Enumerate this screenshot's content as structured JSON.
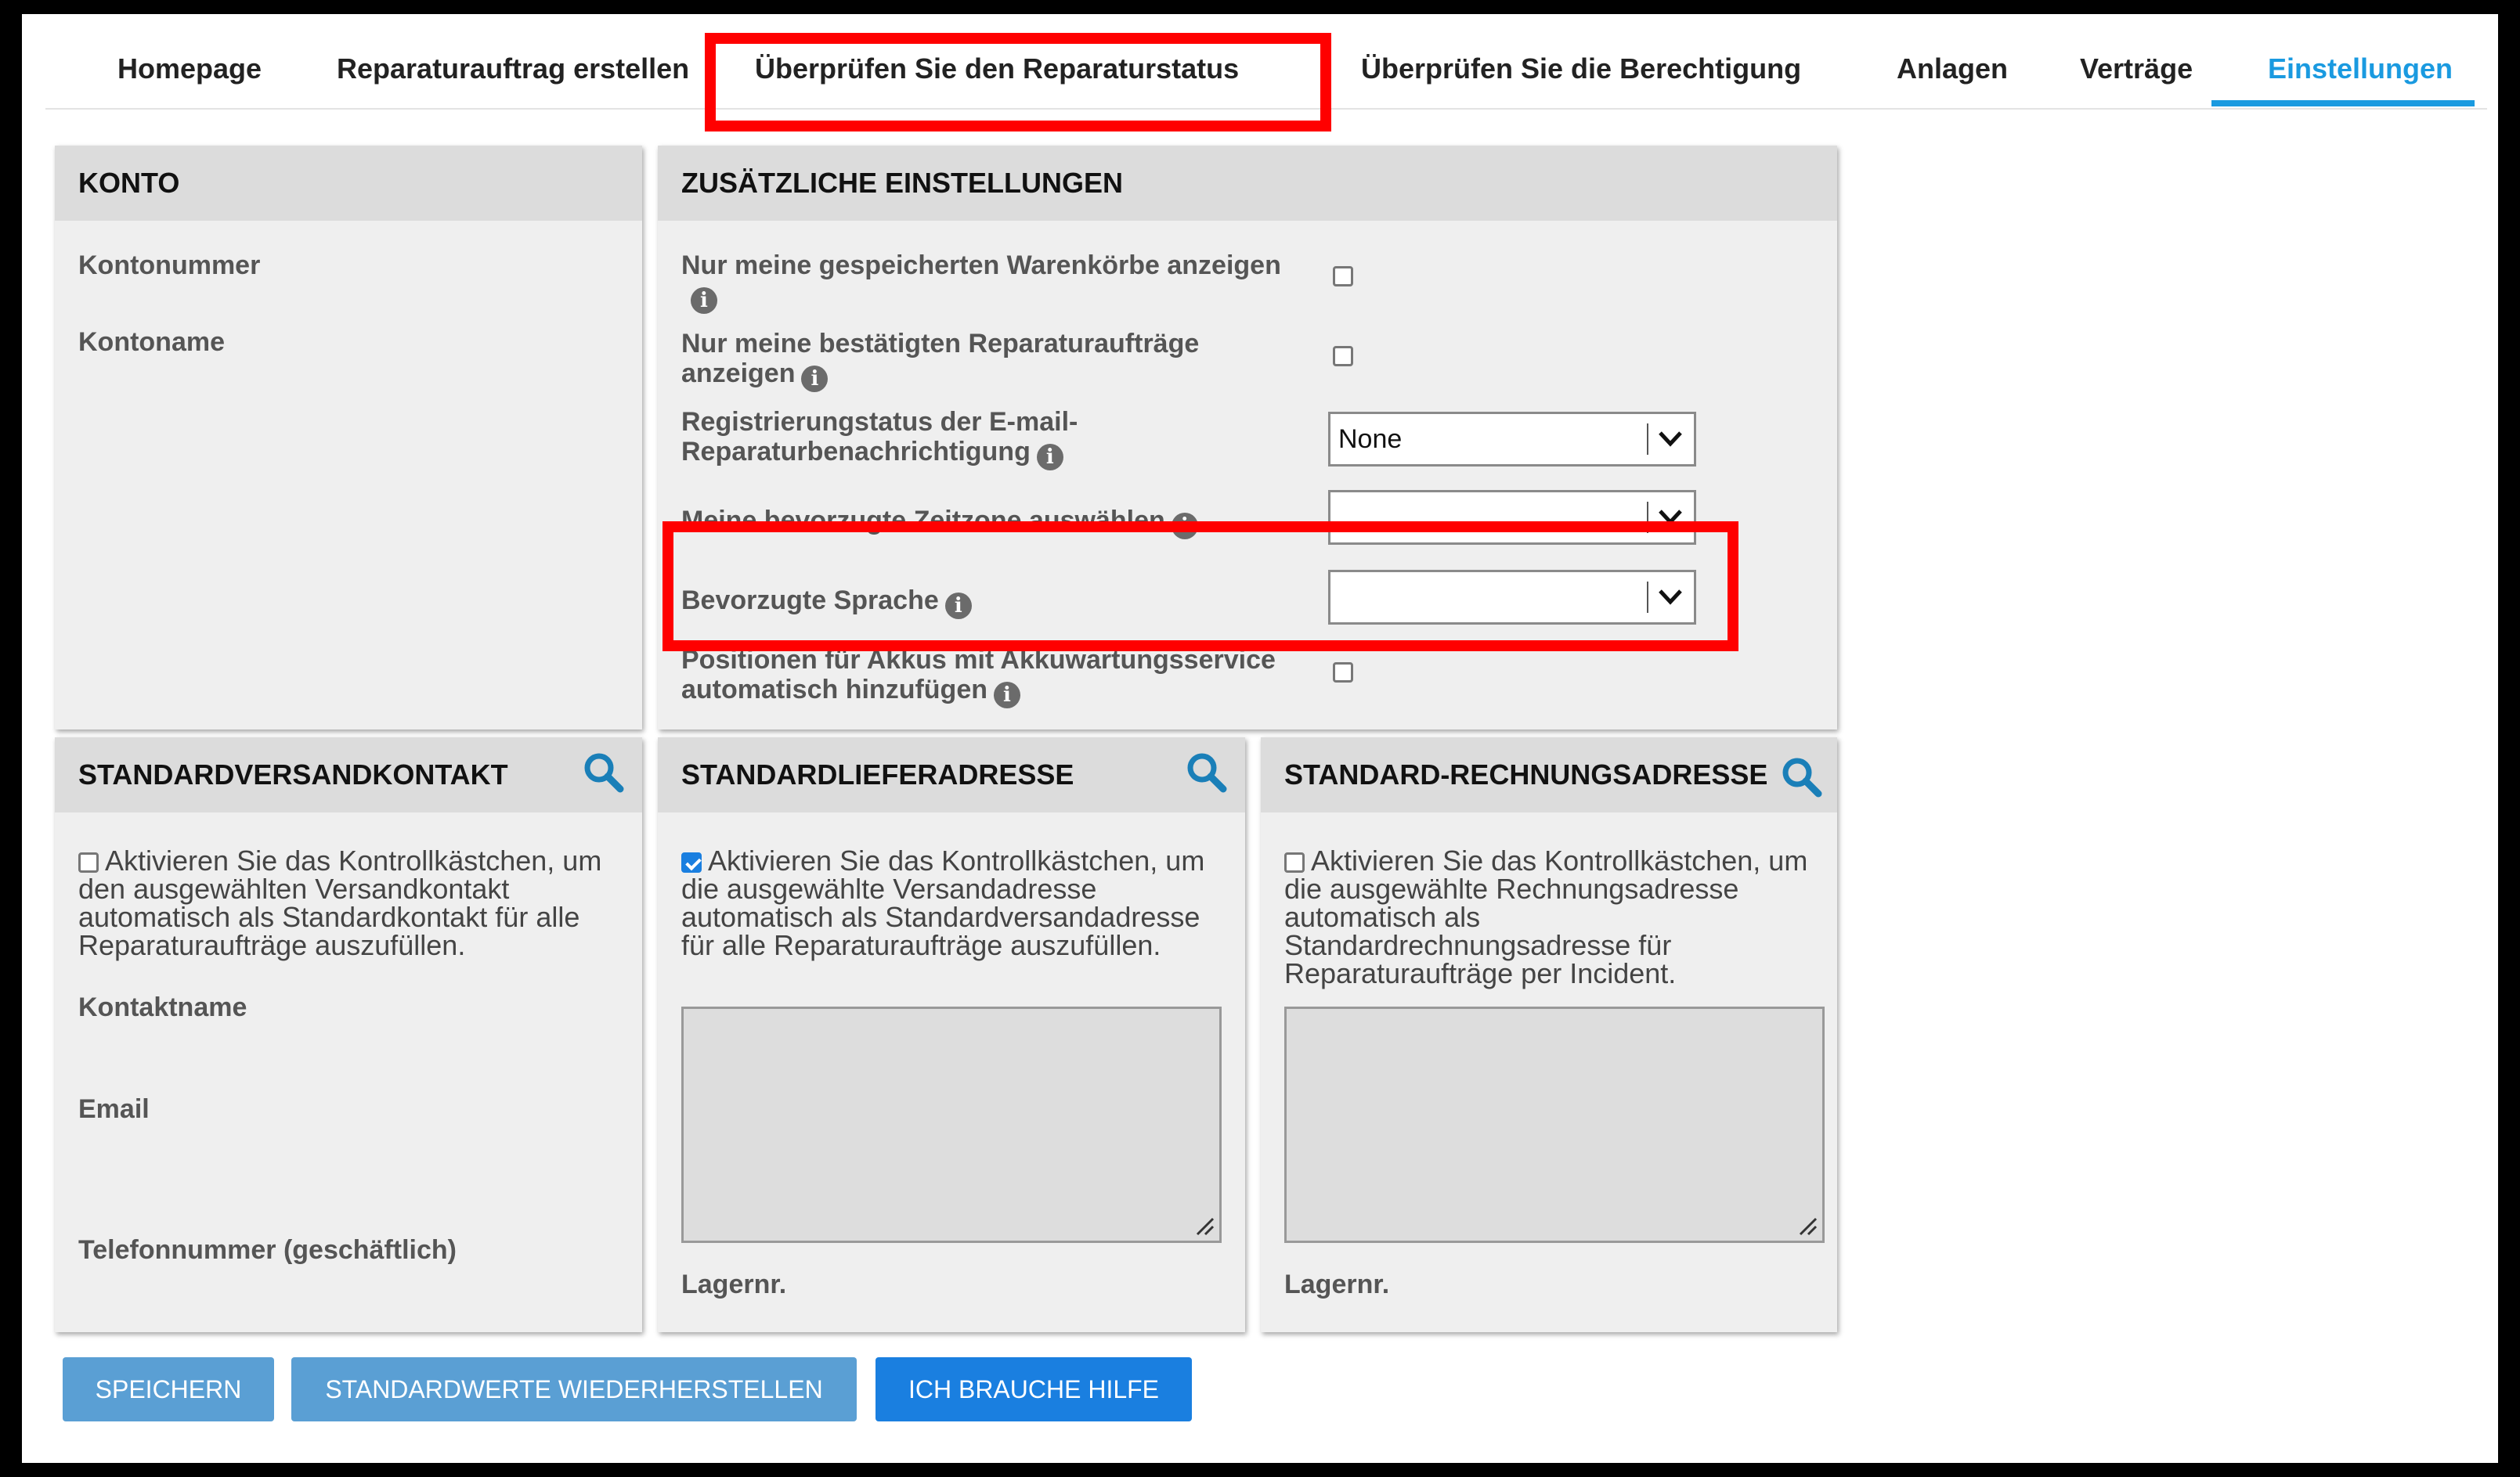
{
  "nav": {
    "tabs": [
      {
        "label": "Homepage"
      },
      {
        "label": "Reparaturauftrag erstellen"
      },
      {
        "label": "Überprüfen Sie den Reparaturstatus"
      },
      {
        "label": "Überprüfen Sie die Berechtigung"
      },
      {
        "label": "Anlagen"
      },
      {
        "label": "Verträge"
      },
      {
        "label": "Einstellungen"
      }
    ],
    "active_tab": "Einstellungen"
  },
  "konto": {
    "title": "KONTO",
    "account_number_label": "Kontonummer",
    "account_name_label": "Kontoname"
  },
  "settings": {
    "title": "ZUSÄTZLICHE EINSTELLUNGEN",
    "saved_carts_line1": "Nur meine gespeicherten Warenkörbe anzeigen",
    "confirmed_orders_line1": "Nur meine bestätigten Reparaturaufträge",
    "confirmed_orders_line2": "anzeigen",
    "email_status_line1": "Registrierungstatus der E-mail-",
    "email_status_line2": "Reparaturbenachrichtigung",
    "email_status_value": "None",
    "timezone_label": "Meine bevorzugte Zeitzone auswählen",
    "timezone_value": "",
    "language_label": "Bevorzugte Sprache",
    "language_value": "",
    "battery_line1": "Positionen für Akkus mit Akkuwartungsservice",
    "battery_line2": "automatisch hinzufügen",
    "info_glyph": "i"
  },
  "shipping_contact": {
    "title": "STANDARDVERSANDKONTAKT",
    "checkbox_text": "Aktivieren Sie das Kontrollkästchen, um den ausgewählten Versandkontakt automatisch als Standardkontakt für alle Reparaturaufträge auszufüllen.",
    "checked": false,
    "contact_name_label": "Kontaktname",
    "email_label": "Email",
    "phone_label": "Telefonnummer (geschäftlich)"
  },
  "delivery_address": {
    "title": "STANDARDLIEFERADRESSE",
    "checkbox_text": "Aktivieren Sie das Kontrollkästchen, um die ausgewählte Versandadresse automatisch als Standardversandadresse für alle Reparaturaufträge auszufüllen.",
    "checked": true,
    "storage_label": "Lagernr."
  },
  "billing_address": {
    "title": "STANDARD-RECHNUNGSADRESSE",
    "checkbox_text": "Aktivieren Sie das Kontrollkästchen, um die ausgewählte Rechnungsadresse automatisch als Standardrechnungsadresse für Reparaturaufträge per Incident.",
    "checked": false,
    "storage_label": "Lagernr."
  },
  "buttons": {
    "save": "SPEICHERN",
    "restore": "STANDARDWERTE WIEDERHERSTELLEN",
    "help": "ICH BRAUCHE HILFE"
  },
  "colors": {
    "accent": "#1a9ae0",
    "highlight": "#ff0000",
    "button_light": "#5a9fd4",
    "button_primary": "#1a7fe0"
  }
}
